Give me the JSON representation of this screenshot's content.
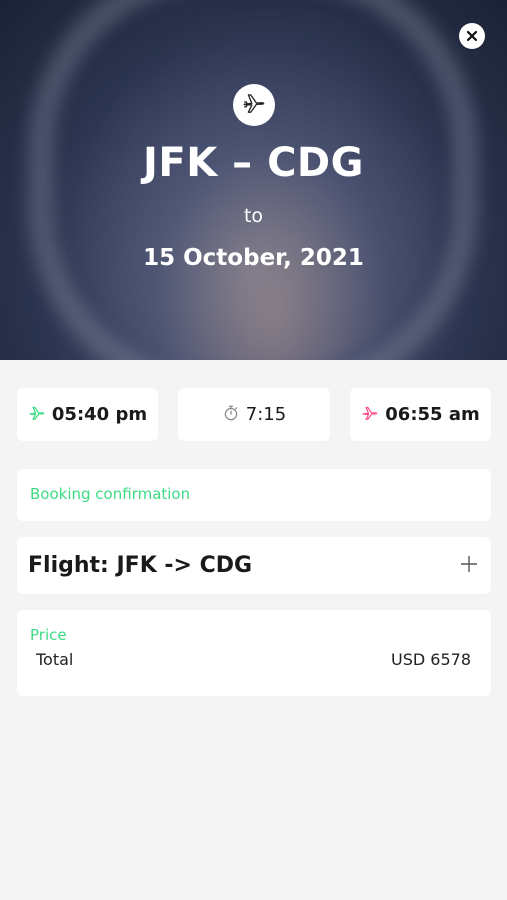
{
  "header": {
    "route": "JFK – CDG",
    "to_label": "to",
    "date": "15 October, 2021",
    "icons": {
      "close": "close-icon",
      "plane": "airplane-icon"
    }
  },
  "times": {
    "departure": "05:40 pm",
    "duration": "7:15",
    "arrival": "06:55 am",
    "colors": {
      "departure_icon": "#3ddc84",
      "arrival_icon": "#ff4f8b",
      "duration_icon": "#888888"
    }
  },
  "booking": {
    "label": "Booking confirmation"
  },
  "flight": {
    "title": "Flight: JFK -> CDG",
    "expand_icon": "plus-icon"
  },
  "price": {
    "label": "Price",
    "total_label": "Total",
    "total_value": "USD 6578"
  },
  "colors": {
    "accent": "#3ddc84",
    "background": "#f4f4f4",
    "card": "#ffffff"
  }
}
